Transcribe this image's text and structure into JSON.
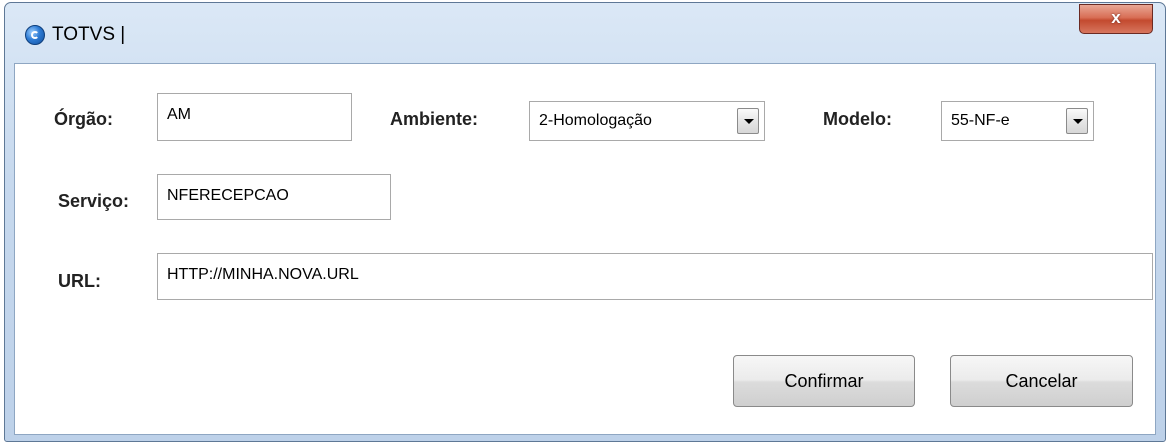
{
  "window": {
    "title": "TOTVS |",
    "close_glyph": "x"
  },
  "form": {
    "orgao": {
      "label": "Órgão:",
      "value": "AM"
    },
    "ambiente": {
      "label": "Ambiente:",
      "selected": "2-Homologação"
    },
    "modelo": {
      "label": "Modelo:",
      "selected": "55-NF-e"
    },
    "servico": {
      "label": "Serviço:",
      "value": "NFERECEPCAO"
    },
    "url": {
      "label": "URL:",
      "value": "HTTP://MINHA.NOVA.URL"
    }
  },
  "buttons": {
    "confirm": "Confirmar",
    "cancel": "Cancelar"
  },
  "icons": {
    "app": "totvs-logo-icon",
    "close": "close-icon",
    "dropdown": "chevron-down-icon"
  }
}
